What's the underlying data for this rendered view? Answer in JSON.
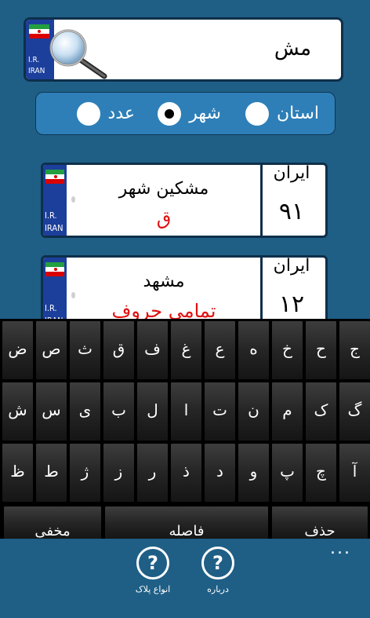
{
  "search": {
    "value": "مش",
    "country_code": "I.R.",
    "country": "IRAN",
    "icon": "magnifier-icon"
  },
  "filter": {
    "options": [
      {
        "label": "استان",
        "selected": false
      },
      {
        "label": "شهر",
        "selected": true
      },
      {
        "label": "عدد",
        "selected": false
      }
    ]
  },
  "plates": [
    {
      "city": "مشکین شهر",
      "letter": "ق",
      "country": "ایران",
      "code": "۹۱",
      "badge_code": "I.R.",
      "badge_country": "IRAN"
    },
    {
      "city": "مشهد",
      "letter": "تمامی حروف",
      "country": "ایران",
      "code": "۱۲",
      "badge_code": "I.R.",
      "badge_country": "IRAN"
    }
  ],
  "keyboard": {
    "row1": [
      "ض",
      "ص",
      "ث",
      "ق",
      "ف",
      "غ",
      "ع",
      "ه",
      "خ",
      "ح",
      "ج"
    ],
    "row2": [
      "ش",
      "س",
      "ی",
      "ب",
      "ل",
      "ا",
      "ت",
      "ن",
      "م",
      "ک",
      "گ"
    ],
    "row3": [
      "ظ",
      "ط",
      "ژ",
      "ز",
      "ر",
      "ذ",
      "د",
      "و",
      "پ",
      "چ",
      "آ"
    ],
    "hide": "مخفی",
    "space": "فاصله",
    "delete": "حذف"
  },
  "appbar": {
    "buttons": [
      {
        "label": "انواع پلاک",
        "icon": "help-icon"
      },
      {
        "label": "درباره",
        "icon": "help-icon"
      }
    ],
    "more": "..."
  },
  "colors": {
    "background": "#1f5f86",
    "plate_strip": "#1c3f9c",
    "letter_red": "#e01010",
    "radio_panel": "#2e7fb8"
  }
}
